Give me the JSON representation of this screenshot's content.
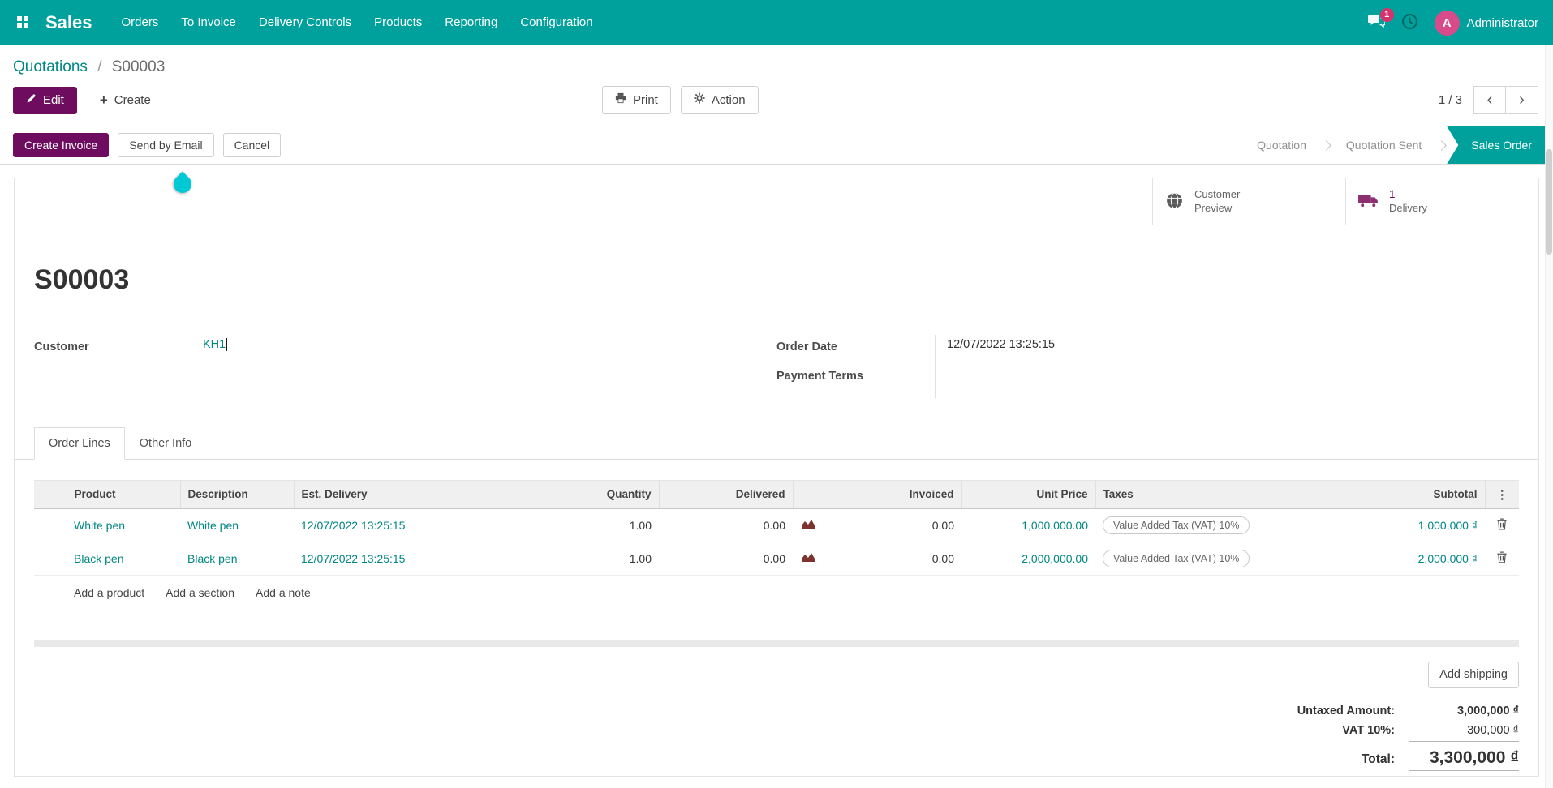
{
  "navbar": {
    "brand": "Sales",
    "menus": [
      "Orders",
      "To Invoice",
      "Delivery Controls",
      "Products",
      "Reporting",
      "Configuration"
    ],
    "messages_badge": "1",
    "user_initial": "A",
    "user_name": "Administrator"
  },
  "breadcrumb": {
    "parent": "Quotations",
    "separator": "/",
    "current": "S00003"
  },
  "control_panel": {
    "edit": "Edit",
    "create": "Create",
    "print": "Print",
    "action": "Action",
    "pager": "1 / 3"
  },
  "statusbar": {
    "create_invoice": "Create Invoice",
    "send_by_email": "Send by Email",
    "cancel": "Cancel",
    "stages": [
      {
        "label": "Quotation",
        "active": false
      },
      {
        "label": "Quotation Sent",
        "active": false
      },
      {
        "label": "Sales Order",
        "active": true
      }
    ]
  },
  "sheet": {
    "stat_buttons": {
      "customer_preview": {
        "line1": "Customer",
        "line2": "Preview"
      },
      "delivery": {
        "count": "1",
        "label": "Delivery"
      }
    },
    "title": "S00003",
    "fields": {
      "customer": {
        "label": "Customer",
        "value": "KH1"
      },
      "order_date": {
        "label": "Order Date",
        "value": "12/07/2022 13:25:15"
      },
      "payment_terms": {
        "label": "Payment Terms",
        "value": ""
      }
    },
    "tabs": [
      {
        "label": "Order Lines",
        "active": true
      },
      {
        "label": "Other Info",
        "active": false
      }
    ],
    "order_lines": {
      "headers": {
        "product": "Product",
        "description": "Description",
        "est_delivery": "Est. Delivery",
        "quantity": "Quantity",
        "delivered": "Delivered",
        "invoiced": "Invoiced",
        "unit_price": "Unit Price",
        "taxes": "Taxes",
        "subtotal": "Subtotal"
      },
      "rows": [
        {
          "product": "White pen",
          "description": "White pen",
          "est_delivery": "12/07/2022 13:25:15",
          "quantity": "1.00",
          "delivered": "0.00",
          "invoiced": "0.00",
          "unit_price": "1,000,000.00",
          "taxes": "Value Added Tax (VAT) 10%",
          "subtotal": "1,000,000 ₫"
        },
        {
          "product": "Black pen",
          "description": "Black pen",
          "est_delivery": "12/07/2022 13:25:15",
          "quantity": "1.00",
          "delivered": "0.00",
          "invoiced": "0.00",
          "unit_price": "2,000,000.00",
          "taxes": "Value Added Tax (VAT) 10%",
          "subtotal": "2,000,000 ₫"
        }
      ],
      "links": [
        "Add a product",
        "Add a section",
        "Add a note"
      ]
    },
    "totals": {
      "add_shipping": "Add shipping",
      "untaxed_label": "Untaxed Amount:",
      "untaxed_value": "3,000,000 ₫",
      "vat_label": "VAT 10%:",
      "vat_value": "300,000 ₫",
      "total_label": "Total:",
      "total_value": "3,300,000 ₫"
    }
  },
  "icons": {
    "plus": "+",
    "chevron_left": "‹",
    "chevron_right": "›",
    "column_options": "⋮"
  },
  "colors": {
    "navbar_teal": "#00A09D",
    "link_teal": "#008784",
    "primary_magenta": "#6E0C5F",
    "badge_magenta": "#D6336C",
    "droplet_cyan": "#00C8D4"
  }
}
